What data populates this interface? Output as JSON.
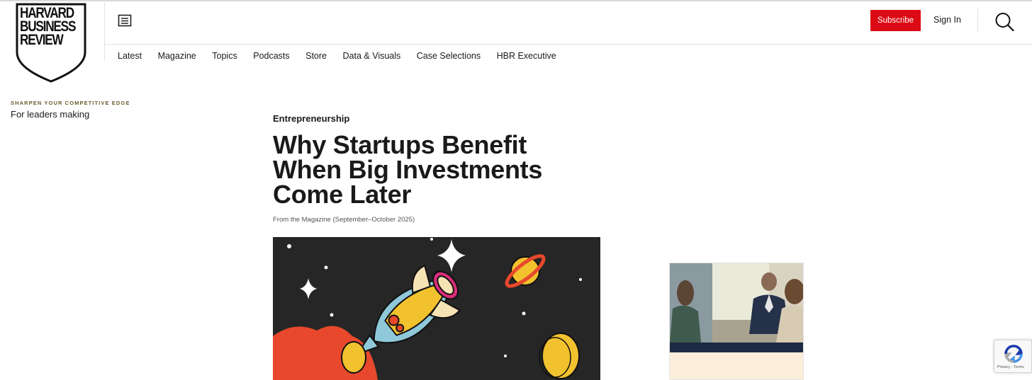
{
  "brand": {
    "logo_lines": [
      "HARVARD",
      "BUSINESS",
      "REVIEW"
    ]
  },
  "header": {
    "subscribe_label": "Subscribe",
    "signin_label": "Sign In"
  },
  "nav": {
    "items": [
      "Latest",
      "Magazine",
      "Topics",
      "Podcasts",
      "Store",
      "Data & Visuals",
      "Case Selections",
      "HBR Executive"
    ]
  },
  "article": {
    "topic": "Entrepreneurship",
    "title": "Why Startups Benefit When Big Investments Come Later",
    "source": "From the Magazine (September–October 2025)"
  },
  "ad": {
    "kicker": "SHARPEN YOUR COMPETITIVE EDGE",
    "title": "For leaders making"
  },
  "recaptcha": {
    "terms": "Privacy - Terms"
  },
  "colors": {
    "accent": "#dc0a14",
    "text": "#1a1a1a",
    "ad_band": "#1f2a44",
    "ad_body": "#fbefdc"
  },
  "icons": {
    "menu": "menu-icon",
    "search": "search-icon",
    "recaptcha": "recaptcha-icon"
  }
}
